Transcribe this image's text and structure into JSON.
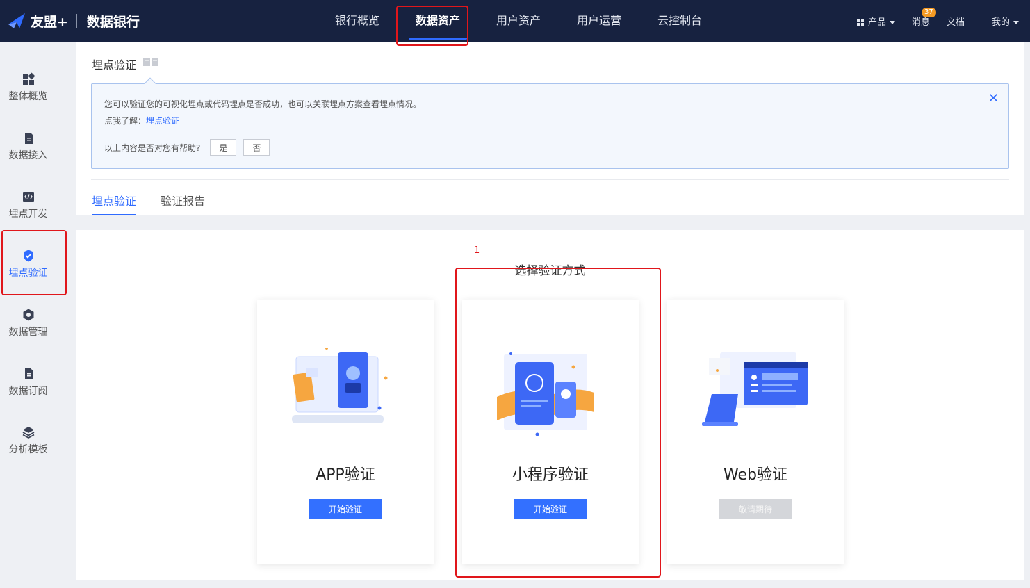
{
  "topbar": {
    "logo_text": "友盟+",
    "product_name": "数据银行",
    "nav": [
      {
        "label": "银行概览",
        "active": false
      },
      {
        "label": "数据资产",
        "active": true
      },
      {
        "label": "用户资产",
        "active": false
      },
      {
        "label": "用户运营",
        "active": false
      },
      {
        "label": "云控制台",
        "active": false
      }
    ],
    "right": {
      "products_label": "产品",
      "messages_label": "消息",
      "messages_badge": "37",
      "docs_label": "文档",
      "account_label": "我的"
    }
  },
  "sidebar": {
    "items": [
      {
        "label": "整体概览",
        "icon": "dashboard-icon",
        "active": false
      },
      {
        "label": "数据接入",
        "icon": "document-icon",
        "active": false
      },
      {
        "label": "埋点开发",
        "icon": "code-icon",
        "active": false
      },
      {
        "label": "埋点验证",
        "icon": "shield-check-icon",
        "active": true
      },
      {
        "label": "数据管理",
        "icon": "hexagon-icon",
        "active": false
      },
      {
        "label": "数据订阅",
        "icon": "document-icon",
        "active": false
      },
      {
        "label": "分析模板",
        "icon": "layers-icon",
        "active": false
      }
    ]
  },
  "header": {
    "title": "埋点验证",
    "tip": {
      "line1": "您可以验证您的可视化埋点或代码埋点是否成功，也可以关联埋点方案查看埋点情况。",
      "line2_prefix": "点我了解：",
      "line2_link": "埋点验证",
      "question": "以上内容是否对您有帮助?",
      "yes_label": "是",
      "no_label": "否",
      "close_glyph": "✕"
    },
    "tabs": [
      {
        "label": "埋点验证",
        "active": true
      },
      {
        "label": "验证报告",
        "active": false
      }
    ]
  },
  "content": {
    "step_number": "1",
    "section_title": "选择验证方式",
    "cards": [
      {
        "title": "APP验证",
        "button": "开始验证",
        "enabled": true
      },
      {
        "title": "小程序验证",
        "button": "开始验证",
        "enabled": true
      },
      {
        "title": "Web验证",
        "button": "敬请期待",
        "enabled": false
      }
    ]
  },
  "colors": {
    "topbar_bg": "#172240",
    "accent": "#2f6bff",
    "highlight_red": "#e0161b",
    "disabled_btn": "#d4d6da"
  }
}
